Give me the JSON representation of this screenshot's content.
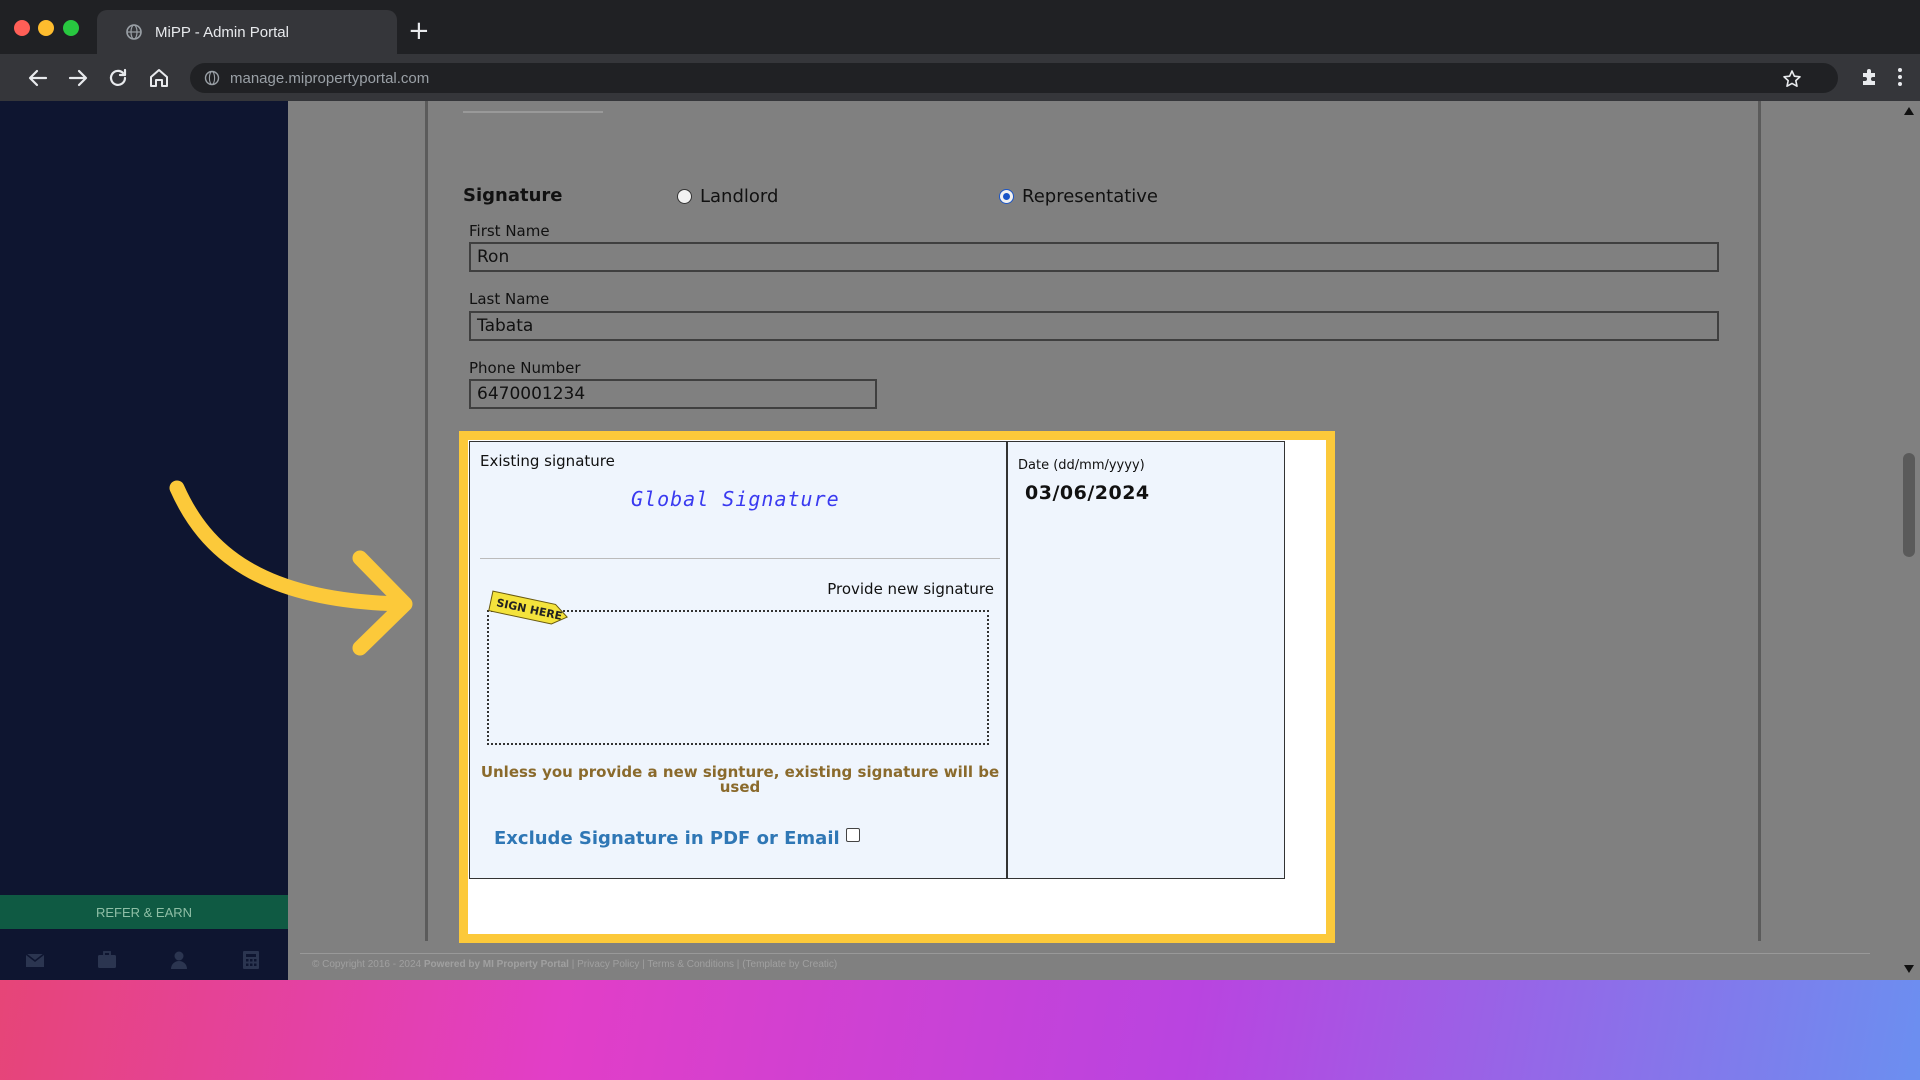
{
  "browser": {
    "tab_title": "MiPP - Admin Portal",
    "new_tab": "+",
    "url": "manage.mipropertyportal.com"
  },
  "sidebar": {
    "refer_label": "REFER & EARN",
    "icons": [
      "mail-icon",
      "briefcase-icon",
      "user-icon",
      "calculator-icon"
    ]
  },
  "form": {
    "signature_heading": "Signature",
    "radio_landlord": "Landlord",
    "radio_representative": "Representative",
    "selected_role": "Representative",
    "first_name_label": "First Name",
    "first_name_value": "Ron",
    "last_name_label": "Last Name",
    "last_name_value": "Tabata",
    "phone_label": "Phone Number",
    "phone_value": "6470001234"
  },
  "signature_box": {
    "existing_label": "Existing signature",
    "existing_value": "Global Signature",
    "provide_label": "Provide new signature",
    "sign_here_tag": "SIGN HERE",
    "warning": "Unless you provide a new signture, existing signature will be used",
    "exclude_label": "Exclude Signature in PDF or Email",
    "exclude_checked": false,
    "date_label": "Date (dd/mm/yyyy)",
    "date_value": "03/06/2024"
  },
  "footer": {
    "copyright": "© Copyright 2016 - 2024",
    "powered_by": "Powered by MI Property Portal",
    "privacy": "Privacy Policy",
    "terms": "Terms & Conditions",
    "template_credit": "(Template by Creatic)"
  },
  "colors": {
    "highlight": "#fcc93a",
    "sidebar": "#0e1530",
    "refer_bg": "#0f5a43",
    "link_blue": "#2f77b5",
    "warning_brown": "#8a6a2c"
  }
}
